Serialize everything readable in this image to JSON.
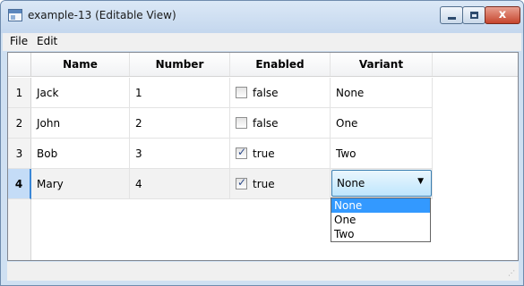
{
  "window": {
    "title": "example-13 (Editable View)",
    "close_glyph": "x"
  },
  "menu": {
    "items": [
      {
        "label": "File"
      },
      {
        "label": "Edit"
      }
    ]
  },
  "table": {
    "columns": [
      "Name",
      "Number",
      "Enabled",
      "Variant"
    ],
    "rows": [
      {
        "index": "1",
        "name": "Jack",
        "number": "1",
        "enabled": "false",
        "checked": false,
        "variant": "None"
      },
      {
        "index": "2",
        "name": "John",
        "number": "2",
        "enabled": "false",
        "checked": false,
        "variant": "One"
      },
      {
        "index": "3",
        "name": "Bob",
        "number": "3",
        "enabled": "true",
        "checked": true,
        "variant": "Two"
      },
      {
        "index": "4",
        "name": "Mary",
        "number": "4",
        "enabled": "true",
        "checked": true,
        "variant": "None"
      }
    ],
    "selected_row": "4"
  },
  "variant_combo": {
    "value": "None",
    "arrow": "▼",
    "options": [
      "None",
      "One",
      "Two"
    ],
    "highlighted": "None"
  },
  "statusbar": {
    "grip": "⋰"
  },
  "colors": {
    "accent": "#3399ff",
    "selected_row_header": "#c4dcf7",
    "close_button": "#c6452e"
  }
}
